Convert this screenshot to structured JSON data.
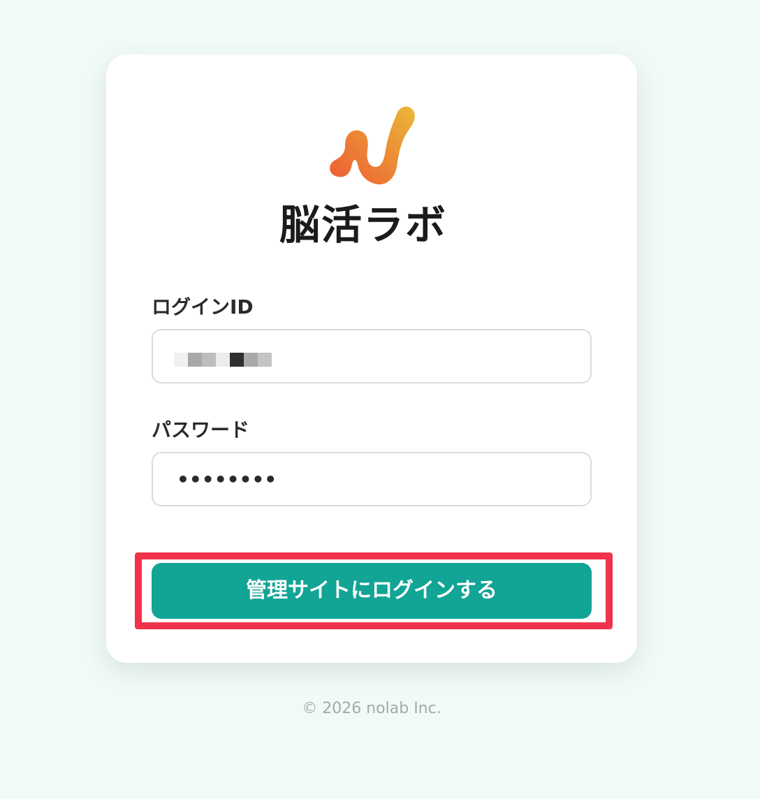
{
  "brand": {
    "name": "脳活ラボ",
    "logo_icon": "brain-link-logo-icon",
    "gradient_start": "#ee5a33",
    "gradient_end": "#eab838"
  },
  "form": {
    "login_id_label": "ログインID",
    "login_id_value_masked": true,
    "password_label": "パスワード",
    "password_value": "••••••••",
    "submit_label": "管理サイトにログインする"
  },
  "colors": {
    "accent": "#12a495",
    "highlight": "#f0334a",
    "background": "#f1faf6"
  },
  "footer": {
    "copyright": "© 2026 nolab Inc."
  }
}
